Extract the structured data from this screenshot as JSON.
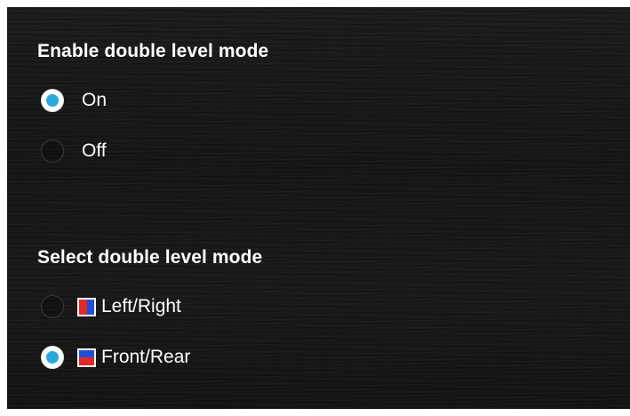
{
  "enable_section": {
    "title": "Enable double level mode",
    "options": [
      {
        "label": "On",
        "selected": true
      },
      {
        "label": "Off",
        "selected": false
      }
    ]
  },
  "mode_section": {
    "title": "Select double level mode",
    "options": [
      {
        "label": "Left/Right",
        "selected": false,
        "icon": "left-right-split-icon"
      },
      {
        "label": "Front/Rear",
        "selected": true,
        "icon": "front-rear-split-icon"
      }
    ]
  },
  "colors": {
    "accent": "#2aa7dc",
    "icon_red": "#e0282a",
    "icon_blue": "#1e4fd8"
  }
}
